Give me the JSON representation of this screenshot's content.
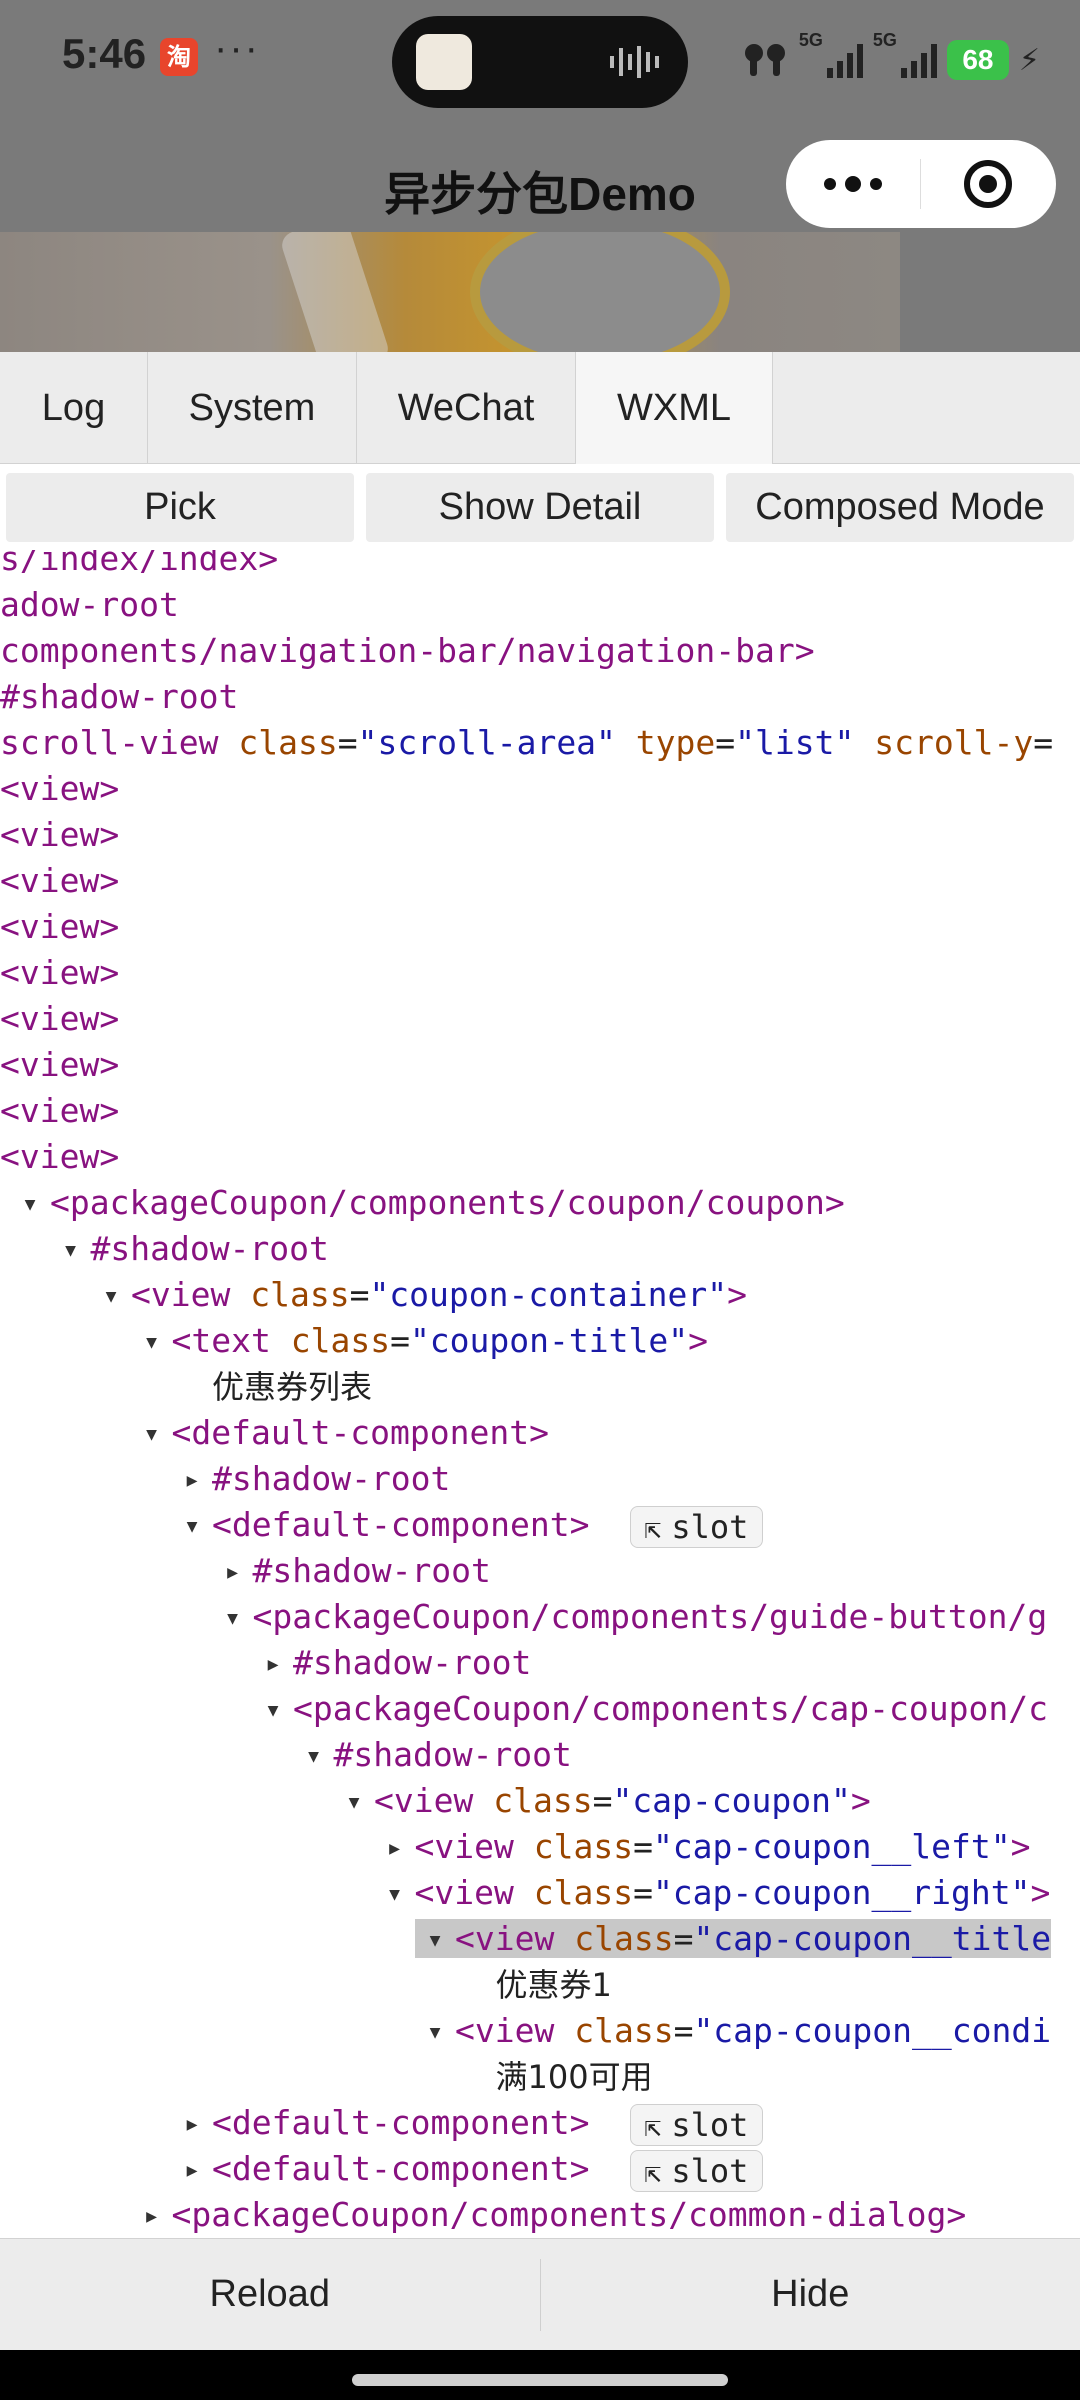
{
  "status_bar": {
    "time": "5:46",
    "app_badge_char": "淘",
    "more_dots": "···",
    "network_label_1": "5G",
    "network_label_2": "5G",
    "battery": "68",
    "icons": [
      "taobao-icon",
      "waveform-icon",
      "earbuds-icon",
      "signal-icon",
      "battery-icon",
      "charging-icon"
    ]
  },
  "nav": {
    "title": "异步分包Demo",
    "capsule_icons": [
      "more-icon",
      "close-target-icon"
    ]
  },
  "devtools": {
    "tabs": [
      {
        "label": "Log",
        "active": false
      },
      {
        "label": "System",
        "active": false
      },
      {
        "label": "WeChat",
        "active": false
      },
      {
        "label": "WXML",
        "active": true
      }
    ],
    "toolbar": {
      "pick": "Pick",
      "show_detail": "Show Detail",
      "composed_mode": "Composed Mode"
    },
    "tree": [
      {
        "indent": 0,
        "tri": "",
        "parts": [
          {
            "c": "tag",
            "t": "s/index/index>"
          }
        ]
      },
      {
        "indent": 0,
        "tri": "",
        "parts": [
          {
            "c": "tag",
            "t": "adow-root"
          }
        ]
      },
      {
        "indent": 0,
        "tri": "",
        "parts": [
          {
            "c": "tag",
            "t": "components/navigation-bar/navigation-bar>"
          }
        ]
      },
      {
        "indent": 0,
        "tri": "",
        "parts": [
          {
            "c": "tag",
            "t": " #shadow-root"
          }
        ]
      },
      {
        "indent": 0,
        "tri": "",
        "parts": [
          {
            "c": "tag",
            "t": "scroll-view "
          },
          {
            "c": "attr",
            "t": "class"
          },
          {
            "c": "eq",
            "t": "="
          },
          {
            "c": "val",
            "t": "\"scroll-area\""
          },
          {
            "c": "eq",
            "t": " "
          },
          {
            "c": "attr",
            "t": "type"
          },
          {
            "c": "eq",
            "t": "="
          },
          {
            "c": "val",
            "t": "\"list\""
          },
          {
            "c": "eq",
            "t": " "
          },
          {
            "c": "attr",
            "t": "scroll-y"
          },
          {
            "c": "eq",
            "t": "="
          }
        ]
      },
      {
        "indent": 0,
        "tri": "",
        "parts": [
          {
            "c": "tag",
            "t": " <view>"
          }
        ]
      },
      {
        "indent": 0,
        "tri": "",
        "parts": [
          {
            "c": "tag",
            "t": " <view>"
          }
        ]
      },
      {
        "indent": 0,
        "tri": "",
        "parts": [
          {
            "c": "tag",
            "t": " <view>"
          }
        ]
      },
      {
        "indent": 0,
        "tri": "",
        "parts": [
          {
            "c": "tag",
            "t": " <view>"
          }
        ]
      },
      {
        "indent": 0,
        "tri": "",
        "parts": [
          {
            "c": "tag",
            "t": " <view>"
          }
        ]
      },
      {
        "indent": 0,
        "tri": "",
        "parts": [
          {
            "c": "tag",
            "t": " <view>"
          }
        ]
      },
      {
        "indent": 0,
        "tri": "",
        "parts": [
          {
            "c": "tag",
            "t": " <view>"
          }
        ]
      },
      {
        "indent": 0,
        "tri": "",
        "parts": [
          {
            "c": "tag",
            "t": " <view>"
          }
        ]
      },
      {
        "indent": 0,
        "tri": "",
        "parts": [
          {
            "c": "tag",
            "t": " <view>"
          }
        ]
      },
      {
        "indent": 0,
        "tri": "▼",
        "parts": [
          {
            "c": "tag",
            "t": "<packageCoupon/components/coupon/coupon>"
          }
        ]
      },
      {
        "indent": 1,
        "tri": "▼",
        "parts": [
          {
            "c": "tag",
            "t": "#shadow-root"
          }
        ]
      },
      {
        "indent": 2,
        "tri": "▼",
        "parts": [
          {
            "c": "tag",
            "t": "<view "
          },
          {
            "c": "attr",
            "t": "class"
          },
          {
            "c": "eq",
            "t": "="
          },
          {
            "c": "val",
            "t": "\"coupon-container\""
          },
          {
            "c": "tag",
            "t": ">"
          }
        ]
      },
      {
        "indent": 3,
        "tri": "▼",
        "parts": [
          {
            "c": "tag",
            "t": "<text "
          },
          {
            "c": "attr",
            "t": "class"
          },
          {
            "c": "eq",
            "t": "="
          },
          {
            "c": "val",
            "t": "\"coupon-title\""
          },
          {
            "c": "tag",
            "t": ">"
          }
        ]
      },
      {
        "indent": 4,
        "tri": "",
        "parts": [
          {
            "c": "txt",
            "t": "优惠券列表"
          }
        ]
      },
      {
        "indent": 3,
        "tri": "▼",
        "parts": [
          {
            "c": "tag",
            "t": "<default-component>"
          }
        ]
      },
      {
        "indent": 4,
        "tri": "▶",
        "parts": [
          {
            "c": "tag",
            "t": "#shadow-root"
          }
        ]
      },
      {
        "indent": 4,
        "tri": "▼",
        "parts": [
          {
            "c": "tag",
            "t": "<default-component>"
          }
        ],
        "slot": "slot"
      },
      {
        "indent": 5,
        "tri": "▶",
        "parts": [
          {
            "c": "tag",
            "t": "#shadow-root"
          }
        ]
      },
      {
        "indent": 5,
        "tri": "▼",
        "parts": [
          {
            "c": "tag",
            "t": "<packageCoupon/components/guide-button/g"
          }
        ]
      },
      {
        "indent": 6,
        "tri": "▶",
        "parts": [
          {
            "c": "tag",
            "t": "#shadow-root"
          }
        ]
      },
      {
        "indent": 6,
        "tri": "▼",
        "parts": [
          {
            "c": "tag",
            "t": "<packageCoupon/components/cap-coupon/c"
          }
        ]
      },
      {
        "indent": 7,
        "tri": "▼",
        "parts": [
          {
            "c": "tag",
            "t": "#shadow-root"
          }
        ]
      },
      {
        "indent": 8,
        "tri": "▼",
        "parts": [
          {
            "c": "tag",
            "t": "<view "
          },
          {
            "c": "attr",
            "t": "class"
          },
          {
            "c": "eq",
            "t": "="
          },
          {
            "c": "val",
            "t": "\"cap-coupon\""
          },
          {
            "c": "tag",
            "t": ">"
          }
        ]
      },
      {
        "indent": 9,
        "tri": "▶",
        "parts": [
          {
            "c": "tag",
            "t": "<view "
          },
          {
            "c": "attr",
            "t": "class"
          },
          {
            "c": "eq",
            "t": "="
          },
          {
            "c": "val",
            "t": "\"cap-coupon__left\""
          },
          {
            "c": "tag",
            "t": ">"
          }
        ]
      },
      {
        "indent": 9,
        "tri": "▼",
        "parts": [
          {
            "c": "tag",
            "t": "<view "
          },
          {
            "c": "attr",
            "t": "class"
          },
          {
            "c": "eq",
            "t": "="
          },
          {
            "c": "val",
            "t": "\"cap-coupon__right\""
          },
          {
            "c": "tag",
            "t": ">"
          }
        ]
      },
      {
        "indent": 10,
        "tri": "▼",
        "selected": true,
        "parts": [
          {
            "c": "tag",
            "t": "<view "
          },
          {
            "c": "attr",
            "t": "class"
          },
          {
            "c": "eq",
            "t": "="
          },
          {
            "c": "val",
            "t": "\"cap-coupon__title"
          }
        ]
      },
      {
        "indent": 11,
        "tri": "",
        "parts": [
          {
            "c": "txt",
            "t": "优惠券1"
          }
        ]
      },
      {
        "indent": 10,
        "tri": "▼",
        "parts": [
          {
            "c": "tag",
            "t": "<view "
          },
          {
            "c": "attr",
            "t": "class"
          },
          {
            "c": "eq",
            "t": "="
          },
          {
            "c": "val",
            "t": "\"cap-coupon__condi"
          }
        ]
      },
      {
        "indent": 11,
        "tri": "",
        "parts": [
          {
            "c": "txt",
            "t": "满100可用"
          }
        ]
      },
      {
        "indent": 4,
        "tri": "▶",
        "parts": [
          {
            "c": "tag",
            "t": "<default-component>"
          }
        ],
        "slot": "slot"
      },
      {
        "indent": 4,
        "tri": "▶",
        "parts": [
          {
            "c": "tag",
            "t": "<default-component>"
          }
        ],
        "slot": "slot"
      },
      {
        "indent": 3,
        "tri": "▶",
        "parts": [
          {
            "c": "tag",
            "t": "<packageCoupon/components/common-dialog>"
          }
        ]
      }
    ],
    "bottom": {
      "reload": "Reload",
      "hide": "Hide"
    }
  }
}
